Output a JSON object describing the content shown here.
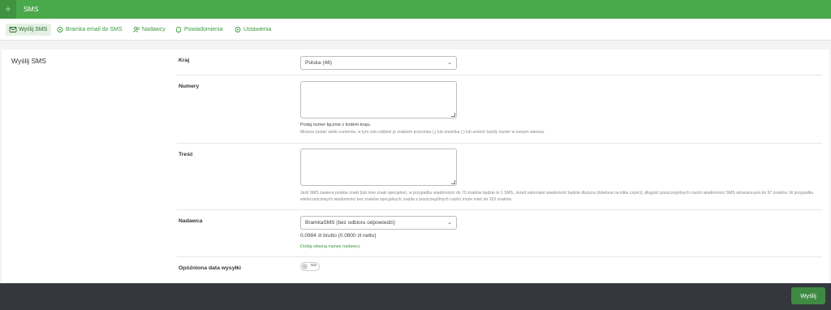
{
  "header": {
    "plus_icon": "+",
    "title": "SMS"
  },
  "tabs": [
    {
      "label": "Wyślij SMS",
      "icon": "mail-icon",
      "active": true
    },
    {
      "label": "Bramka email do SMS",
      "icon": "gear-icon"
    },
    {
      "label": "Nadawcy",
      "icon": "users-icon"
    },
    {
      "label": "Powiadomienia",
      "icon": "bell-icon"
    },
    {
      "label": "Ustawienia",
      "icon": "gear-icon"
    }
  ],
  "form": {
    "section_title": "Wyślij SMS",
    "country": {
      "label": "Kraj",
      "value": "Polska (48)"
    },
    "numbers": {
      "label": "Numery",
      "help_title": "Podaj numer łącznie z kodem kraju.",
      "help_text": "Możesz podać wiele numerów, w tym celu oddziel je znakiem przecinka (,) lub średnika (;) lub umieść każdy numer w nowym wierszu."
    },
    "content": {
      "label": "Treść",
      "help_text": "Jeśli SMS zawiera polskie znaki (lub inne znaki specjalne), w przypadku wiadomości do 70 znaków będzie to 1 SMS. Jeżeli natomiast wiadomość będzie dłuższa (dzielona na kilka części), długość poszczególnych części wiadomości SMS skracana jest do 67 znaków. W przypadku wieloczęściowych wiadomości bez znaków specjalnych, każda z poszczególnych części może mieć do 153 znaków."
    },
    "sender": {
      "label": "Nadawca",
      "value": "BramkaSMS (bez odbioru odpowiedzi)",
      "price": "0.0984 zł brutto (0.0800 zł netto)",
      "add_link": "Dodaj własną nazwę nadawcy"
    },
    "delayed": {
      "label": "Opóźniona data wysyłki",
      "toggle_label": "Nie"
    }
  },
  "footer": {
    "send_label": "Wyślij"
  },
  "colors": {
    "accent": "#49a94b",
    "footer": "#34383d",
    "button": "#3f8a42"
  }
}
